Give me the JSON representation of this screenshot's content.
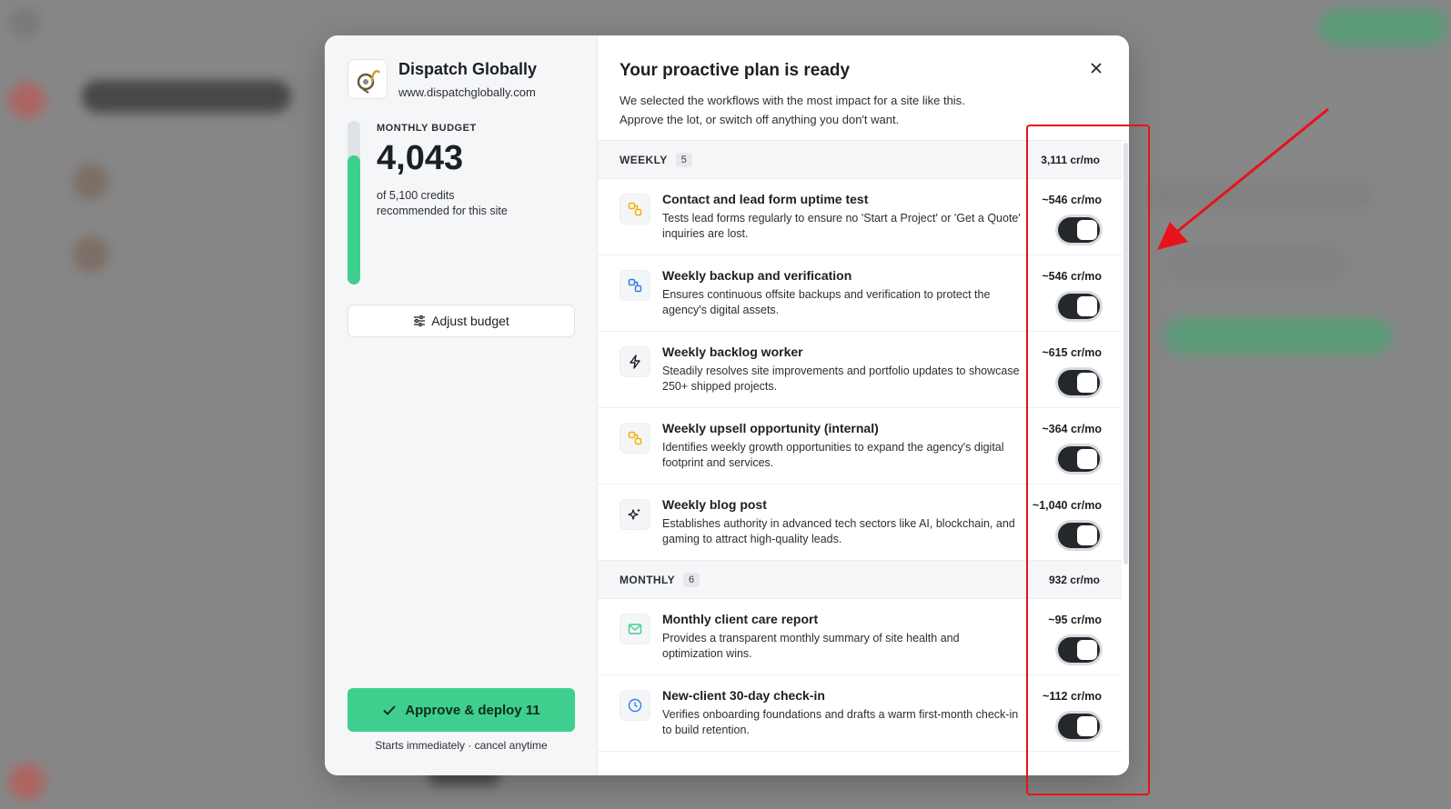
{
  "site": {
    "name": "Dispatch Globally",
    "url": "www.dispatchglobally.com"
  },
  "budget": {
    "label": "MONTHLY BUDGET",
    "value": "4,043",
    "fill_fraction": 0.79,
    "sub_line1": "of 5,100 credits",
    "sub_line2": "recommended for this site"
  },
  "adjust_label": "Adjust budget",
  "approve": {
    "label": "Approve & deploy 11",
    "note": "Starts immediately · cancel anytime"
  },
  "header": {
    "title": "Your proactive plan is ready",
    "subtitle_line1": "We selected the workflows with the most impact for a site like this.",
    "subtitle_line2": "Approve the lot, or switch off anything you don't want."
  },
  "groups": [
    {
      "name": "WEEKLY",
      "count": "5",
      "total": "3,111 cr/mo",
      "items": [
        {
          "icon": "flow-icon",
          "color": "#f5b301",
          "title": "Contact and lead form uptime test",
          "desc": "Tests lead forms regularly to ensure no 'Start a Project' or 'Get a Quote' inquiries are lost.",
          "cost": "~546 cr/mo",
          "enabled": true
        },
        {
          "icon": "flow-icon",
          "color": "#2f80ed",
          "title": "Weekly backup and verification",
          "desc": "Ensures continuous offsite backups and verification to protect the agency's digital assets.",
          "cost": "~546 cr/mo",
          "enabled": true
        },
        {
          "icon": "lightning-icon",
          "color": "#1c1f23",
          "title": "Weekly backlog worker",
          "desc": "Steadily resolves site improvements and portfolio updates to showcase 250+ shipped projects.",
          "cost": "~615 cr/mo",
          "enabled": true
        },
        {
          "icon": "flow-icon",
          "color": "#f5b301",
          "title": "Weekly upsell opportunity (internal)",
          "desc": "Identifies weekly growth opportunities to expand the agency's digital footprint and services.",
          "cost": "~364 cr/mo",
          "enabled": true
        },
        {
          "icon": "sparkles-icon",
          "color": "#1c1f23",
          "title": "Weekly blog post",
          "desc": "Establishes authority in advanced tech sectors like AI, blockchain, and gaming to attract high-quality leads.",
          "cost": "~1,040 cr/mo",
          "enabled": true
        }
      ]
    },
    {
      "name": "MONTHLY",
      "count": "6",
      "total": "932 cr/mo",
      "items": [
        {
          "icon": "mail-icon",
          "color": "#3ecf8e",
          "title": "Monthly client care report",
          "desc": "Provides a transparent monthly summary of site health and optimization wins.",
          "cost": "~95 cr/mo",
          "enabled": true
        },
        {
          "icon": "clock-icon",
          "color": "#2f80ed",
          "title": "New-client 30-day check-in",
          "desc": "Verifies onboarding foundations and drafts a warm first-month check-in to build retention.",
          "cost": "~112 cr/mo",
          "enabled": true
        }
      ]
    }
  ]
}
